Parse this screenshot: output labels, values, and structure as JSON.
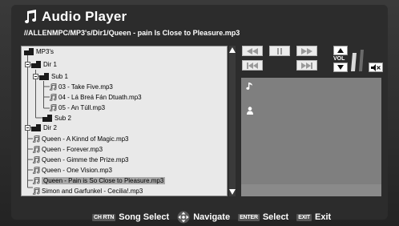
{
  "app": {
    "title": "Audio Player",
    "path": "//ALLENMPC/MP3's/Dir1/Queen - pain Is Close to Pleasure.mp3"
  },
  "tree": {
    "root": "MP3's",
    "dir1": "Dir 1",
    "sub1": "Sub 1",
    "files_sub1": [
      "03 - Take Five.mp3",
      "04 - Lá Breá Fán Dtuath.mp3",
      "05 - An Túll.mp3"
    ],
    "sub2": "Sub 2",
    "dir2": "Dir 2",
    "songs": [
      "Queen - A Kinnd of Magic.mp3",
      "Queen - Forever.mp3",
      "Queen - Gimme the Prize.mp3",
      "Queen - One Vision.mp3",
      "Queen - Pain is So Close to Pleasure.mp3",
      "Simon and Garfunkel - Cecilia!.mp3"
    ],
    "selected_song_index": 4
  },
  "controls": {
    "vol_label": "VOL",
    "icons": [
      "rewind-icon",
      "pause-icon",
      "fast-forward-icon",
      "previous-track-icon",
      "next-track-icon",
      "volume-up-icon",
      "volume-down-icon",
      "mute-icon"
    ]
  },
  "bottom_bar": {
    "song_select_key": "CH RTN",
    "song_select_label": "Song Select",
    "navigate_label": "Navigate",
    "select_key": "ENTER",
    "select_label": "Select",
    "exit_key": "EXIT",
    "exit_label": "Exit"
  },
  "colors": {
    "background": "#2e2e2e",
    "tree_panel": "#e9e9e9",
    "selected_row": "#a8a8a8",
    "info_panel": "#7f7f7f"
  }
}
